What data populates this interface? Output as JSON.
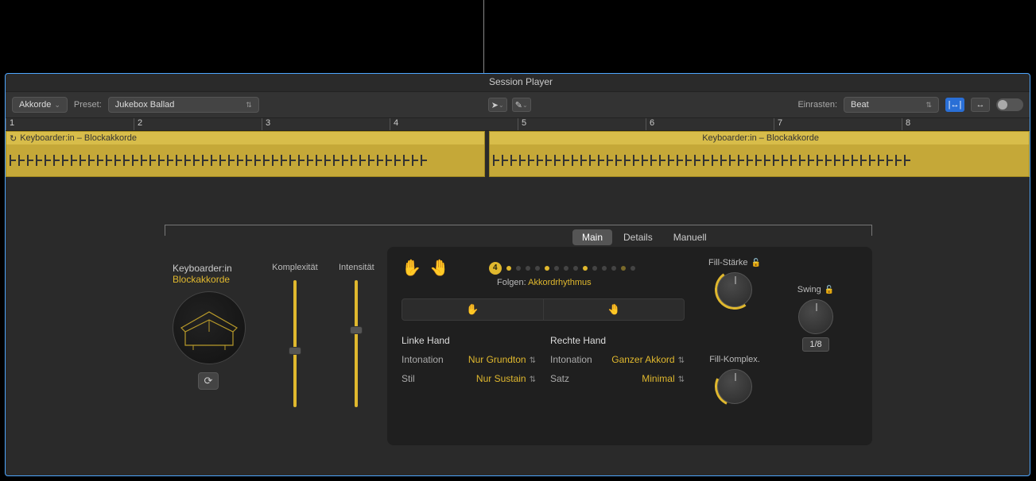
{
  "header": {
    "title": "Session Player"
  },
  "toolbar": {
    "mode_label": "Akkorde",
    "preset_label": "Preset:",
    "preset_value": "Jukebox Ballad",
    "snap_label": "Einrasten:",
    "snap_value": "Beat"
  },
  "ruler": {
    "bars": [
      "1",
      "2",
      "3",
      "4",
      "5",
      "6",
      "7",
      "8"
    ]
  },
  "regions": {
    "r1": {
      "name": "Keyboarder:in – Blockakkorde"
    },
    "r2": {
      "name": "Keyboarder:in – Blockakkorde"
    }
  },
  "tabs": {
    "main": "Main",
    "details": "Details",
    "manual": "Manuell"
  },
  "instrument": {
    "role": "Keyboarder:in",
    "style": "Blockakkorde"
  },
  "sliders": {
    "complexity": "Komplexität",
    "intensity": "Intensität"
  },
  "beat": {
    "badge": "4",
    "follow_label": "Folgen:",
    "follow_value": "Akkordrhythmus"
  },
  "hands": {
    "left_title": "Linke Hand",
    "right_title": "Rechte Hand",
    "intonation_label": "Intonation",
    "style_label": "Stil",
    "satz_label": "Satz",
    "left_intonation": "Nur Grundton",
    "left_style": "Nur Sustain",
    "right_intonation": "Ganzer Akkord",
    "right_satz": "Minimal"
  },
  "knobs": {
    "fill_strength": "Fill-Stärke",
    "fill_complexity": "Fill-Komplex.",
    "swing": "Swing",
    "swing_division": "1/8"
  }
}
